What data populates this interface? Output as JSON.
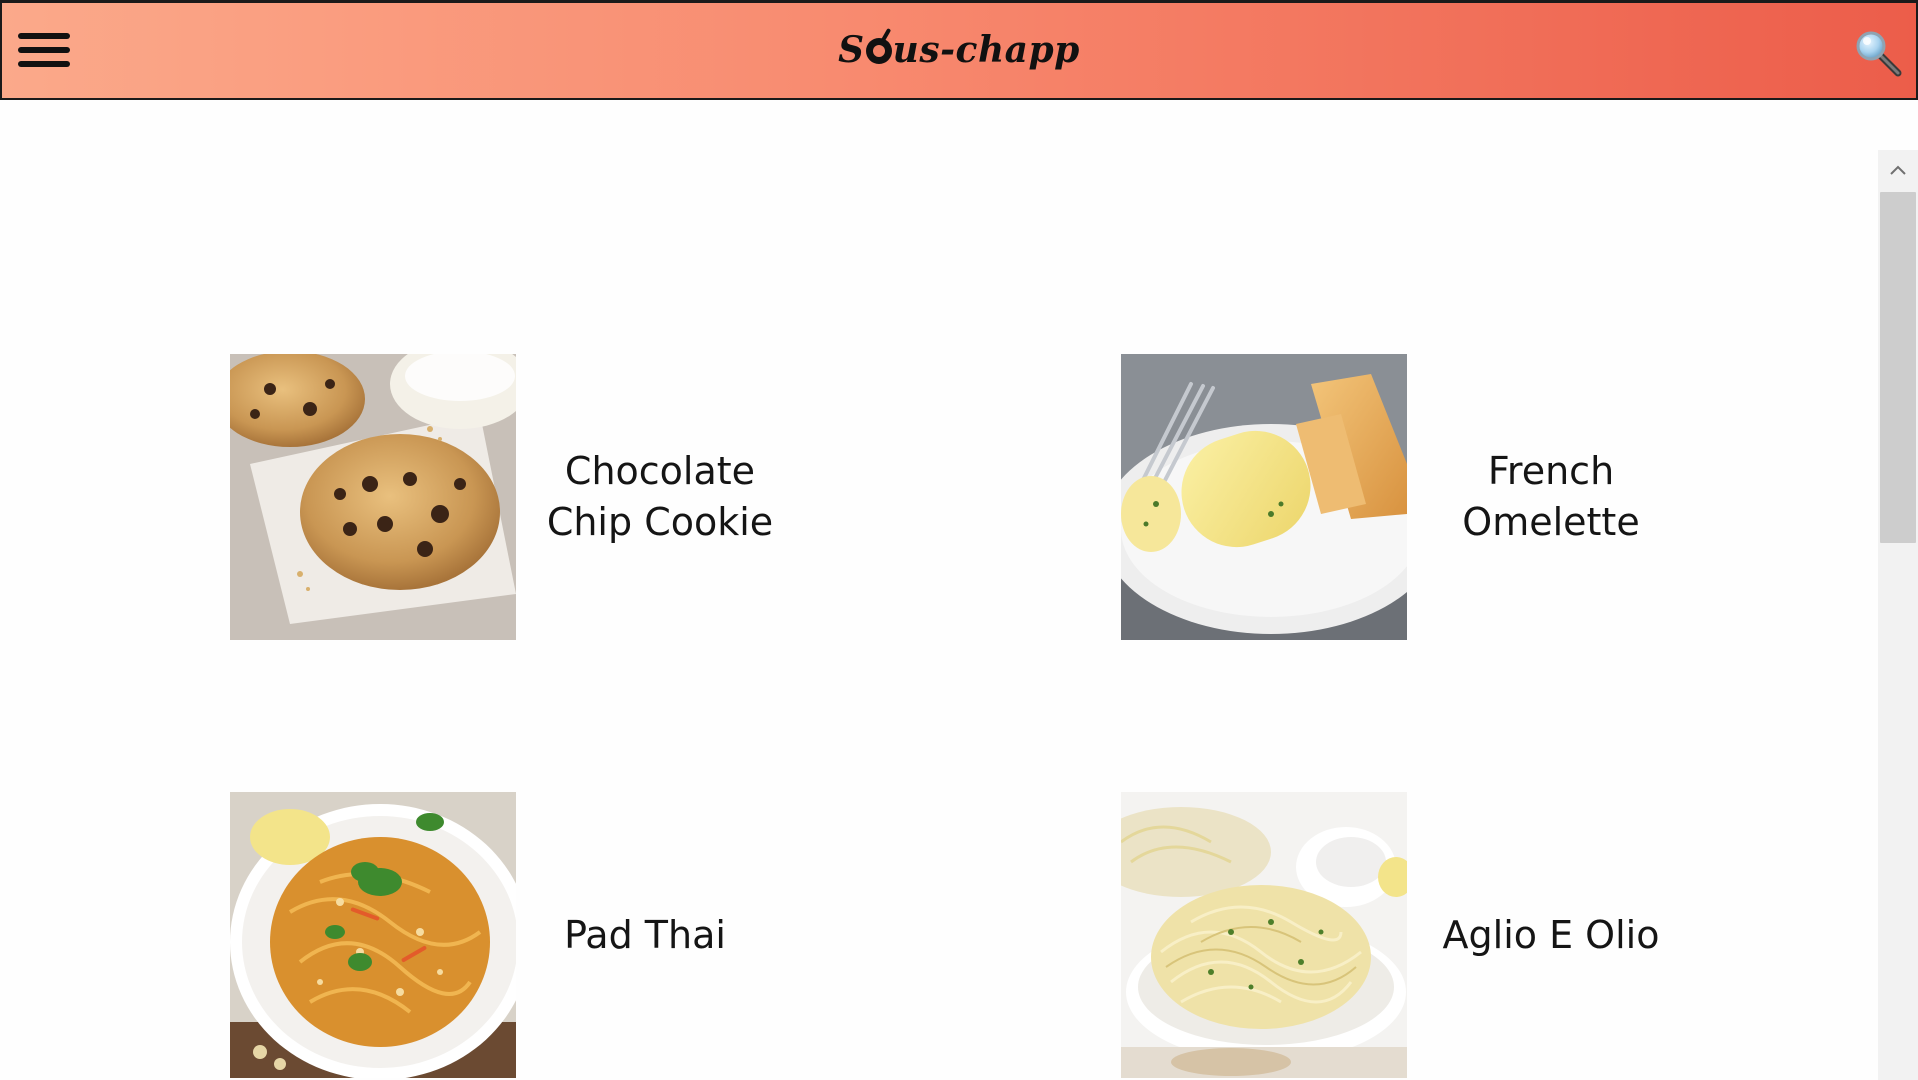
{
  "header": {
    "app_name": "Sous-chapp",
    "logo_prefix": "S",
    "logo_suffix": "us-chapp",
    "menu_icon": "hamburger-menu-icon",
    "search_icon": "magnifier-search-icon",
    "colors": {
      "gradient_start": "#fba98a",
      "gradient_end": "#ec5d4a"
    }
  },
  "scrollbar": {
    "up_arrow": "^"
  },
  "recipes": [
    {
      "title_line1": "Chocolate",
      "title_line2": "Chip Cookie",
      "image": "chocolate-chip-cookie-photo"
    },
    {
      "title_line1": "French",
      "title_line2": "Omelette",
      "image": "french-omelette-photo"
    },
    {
      "title_line1": "Pad Thai",
      "image": "pad-thai-photo"
    },
    {
      "title_line1": "Aglio E Olio",
      "image": "aglio-e-olio-photo"
    }
  ]
}
